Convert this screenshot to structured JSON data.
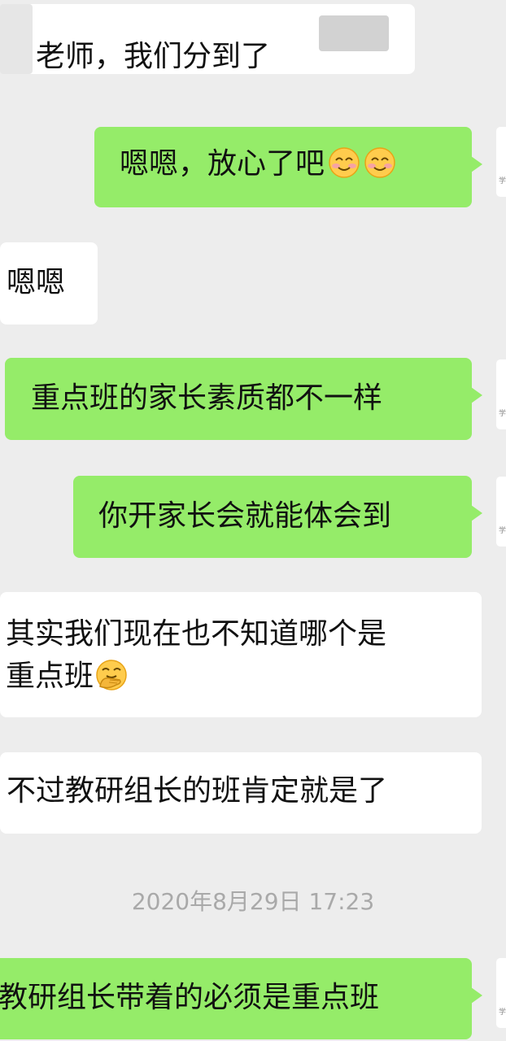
{
  "conversation": {
    "messages": [
      {
        "side": "in",
        "text": "老师，我们分到了"
      },
      {
        "side": "out",
        "text": "嗯嗯，放心了吧"
      },
      {
        "side": "in",
        "text": "嗯嗯"
      },
      {
        "side": "out",
        "text": "重点班的家长素质都不一样"
      },
      {
        "side": "out",
        "text": "你开家长会就能体会到"
      },
      {
        "side": "in",
        "line1": "其实我们现在也不知道哪个是",
        "line2": "重点班"
      },
      {
        "side": "in",
        "text": "不过教研组长的班肯定就是了"
      },
      {
        "side": "out",
        "text": "教研组长带着的必须是重点班"
      }
    ],
    "timestamp": "2020年8月29日 17:23",
    "avatar_mark": "学"
  },
  "emojis": {
    "message_2": [
      "smiling-face-with-smiling-eyes-emoji",
      "smiling-face-with-smiling-eyes-emoji"
    ],
    "message_6": [
      "face-with-hand-over-mouth-emoji"
    ]
  },
  "colors": {
    "background": "#ededed",
    "incoming_bubble": "#ffffff",
    "outgoing_bubble": "#95ec69",
    "timestamp_text": "#a9a9a9"
  }
}
